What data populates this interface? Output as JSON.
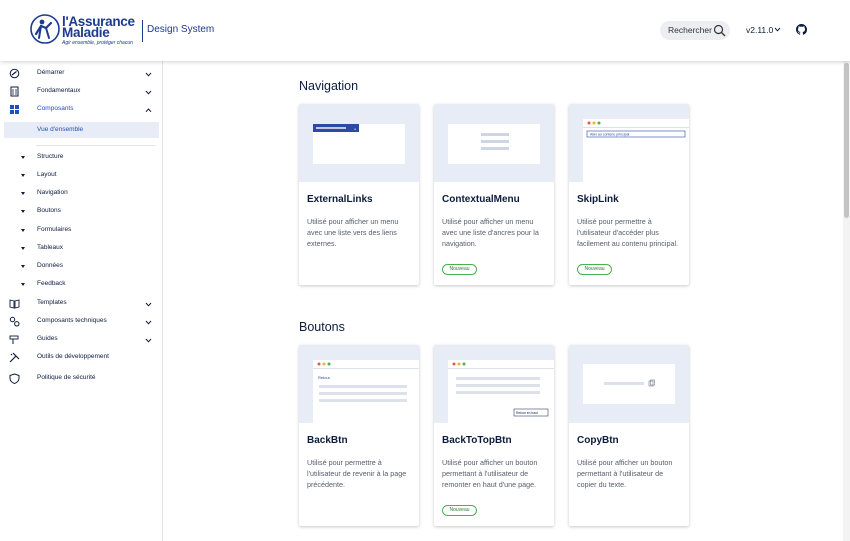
{
  "header": {
    "logo_line1": "l'Assurance",
    "logo_line2": "Maladie",
    "logo_tagline": "Agir ensemble, protéger chacun",
    "site_title": "Design System",
    "search_label": "Rechercher",
    "version": "v2.11.0"
  },
  "sidebar": {
    "items": [
      {
        "label": "Démarrer",
        "icon": "rocket-icon"
      },
      {
        "label": "Fondamentaux",
        "icon": "building-icon"
      },
      {
        "label": "Composants",
        "icon": "grid-icon"
      },
      {
        "label": "Vue d'ensemble"
      },
      {
        "label": "Structure"
      },
      {
        "label": "Layout"
      },
      {
        "label": "Navigation"
      },
      {
        "label": "Boutons"
      },
      {
        "label": "Formulaires"
      },
      {
        "label": "Tableaux"
      },
      {
        "label": "Données"
      },
      {
        "label": "Feedback"
      },
      {
        "label": "Templates",
        "icon": "book-icon"
      },
      {
        "label": "Composants techniques",
        "icon": "gears-icon"
      },
      {
        "label": "Guides",
        "icon": "signpost-icon"
      },
      {
        "label": "Outils de développement",
        "icon": "tools-icon"
      },
      {
        "label": "Politique de sécurité",
        "icon": "shield-icon"
      }
    ]
  },
  "sections": [
    {
      "title": "Navigation",
      "cards": [
        {
          "title": "ExternalLinks",
          "description": "Utilisé pour afficher un menu avec une liste vers des liens externes.",
          "badge": ""
        },
        {
          "title": "ContextualMenu",
          "description": "Utilisé pour afficher un menu avec une liste d'ancres pour la navigation.",
          "badge": "Nouveau"
        },
        {
          "title": "SkipLink",
          "description": "Utilisé pour permettre à l'utilisateur d'accéder plus facilement au contenu principal.",
          "badge": "Nouveau",
          "preview_text": "Aller au contenu principal"
        }
      ]
    },
    {
      "title": "Boutons",
      "cards": [
        {
          "title": "BackBtn",
          "description": "Utilisé pour permettre à l'utilisateur de revenir à la page précédente.",
          "badge": "",
          "preview_text": "Retour"
        },
        {
          "title": "BackToTopBtn",
          "description": "Utilisé pour afficher un bouton permettant à l'utilisateur de remonter en haut d'une page.",
          "badge": "Nouveau",
          "preview_text": "Retour en haut"
        },
        {
          "title": "CopyBtn",
          "description": "Utilisé pour afficher un bouton permettant à l'utilisateur de copier du texte.",
          "badge": ""
        }
      ]
    }
  ],
  "colors": {
    "brand": "#1d3a8f",
    "accent": "#1f4fc1",
    "card_media_bg": "#e7ecf6",
    "badge_green": "#4caf50"
  }
}
